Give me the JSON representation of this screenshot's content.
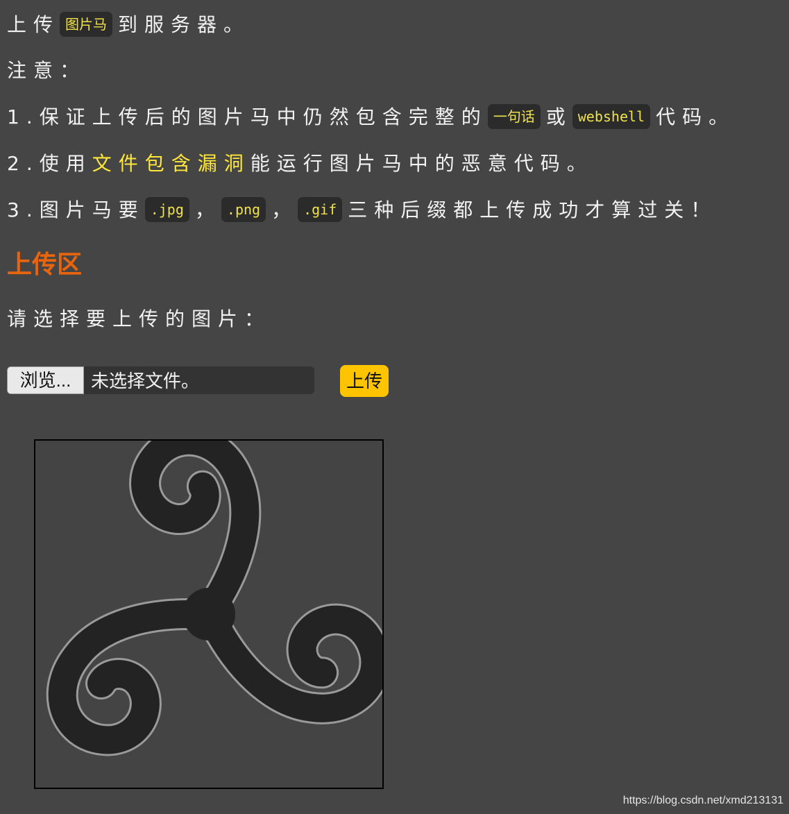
{
  "intro": {
    "upload_prefix": "上传",
    "upload_code": "图片马",
    "upload_suffix": "到服务器。",
    "notice": "注意：",
    "item1_text_a": "1.保证上传后的图片马中仍然包含完整的",
    "item1_code_a": "一句话",
    "item1_text_b": "或",
    "item1_code_b": "webshell",
    "item1_text_c": "代码。",
    "item2_text_a": "2.使用",
    "item2_highlight": "文件包含漏洞",
    "item2_text_b": "能运行图片马中的恶意代码。",
    "item3_text_a": "3.图片马要",
    "item3_code_jpg": ".jpg",
    "item3_sep1": "，",
    "item3_code_png": ".png",
    "item3_sep2": "，",
    "item3_code_gif": ".gif",
    "item3_text_b": "三种后缀都上传成功才算过关！"
  },
  "upload_section": {
    "heading": "上传区",
    "prompt": "请选择要上传的图片：",
    "browse_label": "浏览...",
    "file_status": "未选择文件。",
    "upload_label": "上传"
  },
  "preview": {
    "icon": "triskelion-spiral-icon"
  },
  "watermark": "https://blog.csdn.net/xmd213131",
  "colors": {
    "background": "#454545",
    "heading": "#e8650e",
    "highlight": "#ffe83a",
    "upload_button": "#ffc400",
    "code_bg": "#2b2b2b"
  }
}
